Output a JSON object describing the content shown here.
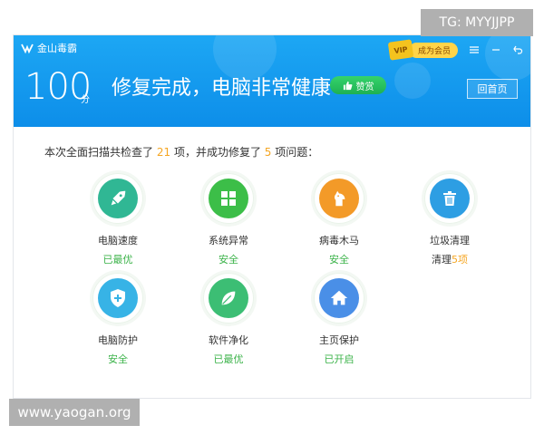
{
  "app": {
    "title": "金山毒霸"
  },
  "header": {
    "vip_badge": "VIP",
    "vip_label": "成为会员",
    "score": "100",
    "score_unit": "分",
    "status_text": "修复完成，电脑非常健康",
    "like_label": "赞赏",
    "home_button": "回首页"
  },
  "summary": {
    "prefix": "本次全面扫描共检查了",
    "checked_count": "21",
    "middle": "项，并成功修复了",
    "fixed_count": "5",
    "suffix": "项问题："
  },
  "items": [
    {
      "label": "电脑速度",
      "status": "已最优",
      "status_color": "#3cb34a",
      "icon": "rocket-icon",
      "color": "#30b794"
    },
    {
      "label": "系统异常",
      "status": "安全",
      "status_color": "#3cb34a",
      "icon": "windows-icon",
      "color": "#3cbe48"
    },
    {
      "label": "病毒木马",
      "status": "安全",
      "status_color": "#3cb34a",
      "icon": "horse-icon",
      "color": "#f39a28"
    },
    {
      "label": "垃圾清理",
      "status_prefix": "清理",
      "status_count": "5",
      "status_suffix": "项",
      "icon": "trash-icon",
      "color": "#2d9ee3"
    },
    {
      "label": "电脑防护",
      "status": "安全",
      "status_color": "#3cb34a",
      "icon": "shield-plus-icon",
      "color": "#37b3e6"
    },
    {
      "label": "软件净化",
      "status": "已最优",
      "status_color": "#3cb34a",
      "icon": "leaf-icon",
      "color": "#3cbe74"
    },
    {
      "label": "主页保护",
      "status": "已开启",
      "status_color": "#3cb34a",
      "icon": "home-icon",
      "color": "#4a8fe7"
    }
  ],
  "watermarks": {
    "tag": "TG: MYYJJPP",
    "site": "www.yaogan.org"
  },
  "colors": {
    "header": "#129bef",
    "accent_orange": "#f5a623",
    "green": "#3cb34a"
  }
}
